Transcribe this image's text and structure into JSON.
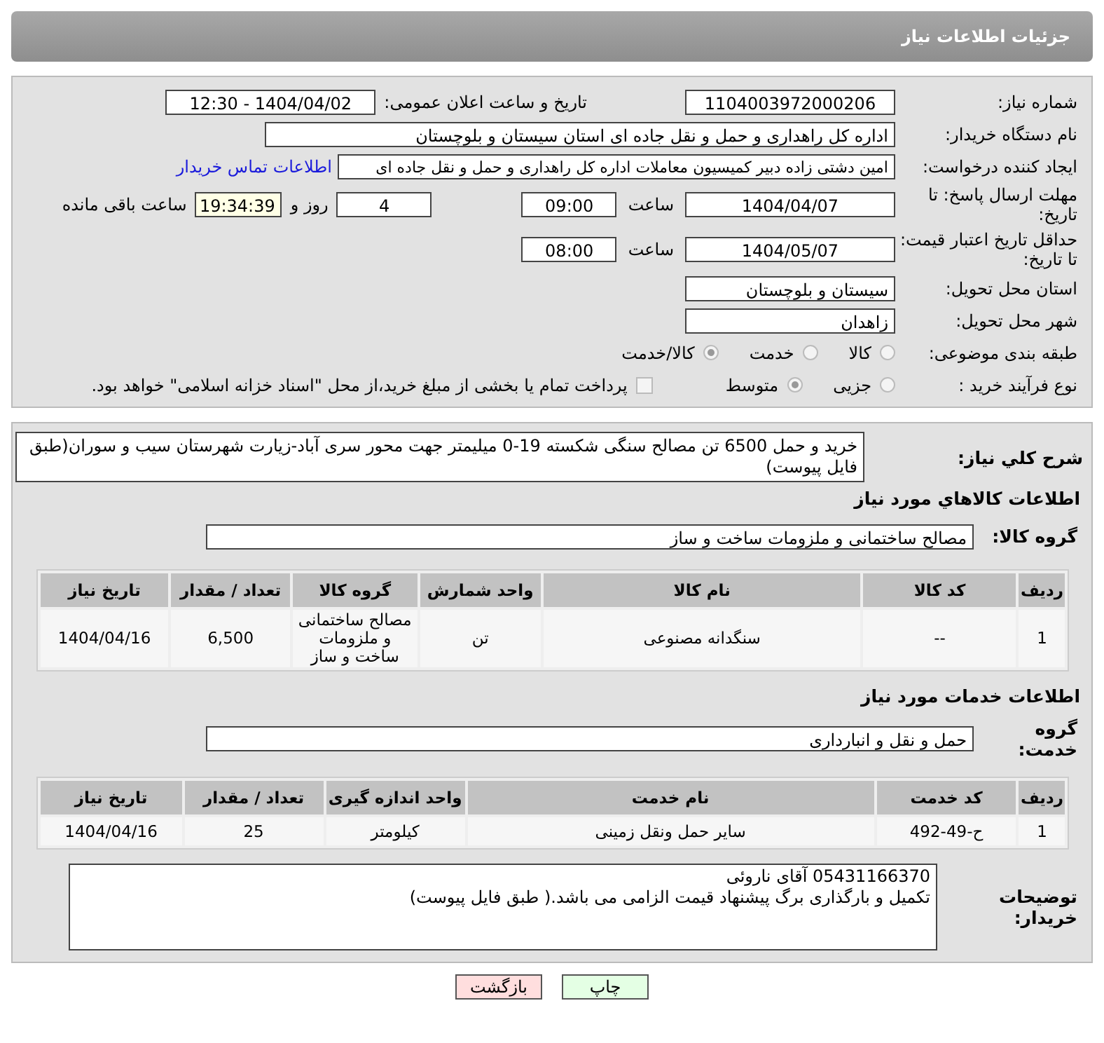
{
  "header": {
    "title": "جزئیات اطلاعات نیاز"
  },
  "need_number": {
    "label": "شماره نیاز:",
    "value": "1104003972000206"
  },
  "announce": {
    "label": "تاریخ و ساعت اعلان عمومی:",
    "value": "1404/04/02 - 12:30"
  },
  "buyer_org": {
    "label": "نام دستگاه خریدار:",
    "value": "اداره کل راهداری و حمل و نقل جاده ای استان سیستان و بلوچستان"
  },
  "requester": {
    "label": "ایجاد کننده درخواست:",
    "value": "امین دشتی زاده دبیر کمیسیون معاملات اداره کل راهداری و حمل و نقل جاده ای",
    "contact_link": "اطلاعات تماس خریدار"
  },
  "reply_deadline": {
    "label": "مهلت ارسال پاسخ: تا تاریخ:",
    "date": "1404/04/07",
    "time_label": "ساعت",
    "time": "09:00",
    "days": "4",
    "days_label": "روز و",
    "remaining": "19:34:39",
    "remaining_label": "ساعت باقی مانده"
  },
  "price_validity": {
    "label": "حداقل تاریخ اعتبار قیمت: تا تاریخ:",
    "date": "1404/05/07",
    "time_label": "ساعت",
    "time": "08:00"
  },
  "province": {
    "label": "استان محل تحویل:",
    "value": "سیستان و بلوچستان"
  },
  "city": {
    "label": "شهر محل تحویل:",
    "value": "زاهدان"
  },
  "category": {
    "label": "طبقه بندی موضوعی:",
    "options": [
      {
        "label": "کالا",
        "selected": false
      },
      {
        "label": "خدمت",
        "selected": false
      },
      {
        "label": "کالا/خدمت",
        "selected": true
      }
    ]
  },
  "process": {
    "label": "نوع فرآیند خرید :",
    "options": [
      {
        "label": "جزیی",
        "selected": false
      },
      {
        "label": "متوسط",
        "selected": true
      }
    ],
    "payment": {
      "checked": false,
      "text": "پرداخت تمام یا بخشی از مبلغ خرید،از محل \"اسناد خزانه اسلامی\" خواهد بود."
    }
  },
  "description": {
    "label": "شرح کلي نياز:",
    "value": "خرید و حمل 6500 تن مصالح سنگی شکسته 19-0 میلیمتر جهت محور سری آباد-زیارت شهرستان سیب و سوران(طبق فایل پیوست)"
  },
  "goods": {
    "title": "اطلاعات کالاهاي مورد نياز",
    "group_label": "گروه کالا:",
    "group": "مصالح ساختمانی و ملزومات ساخت و ساز",
    "columns": [
      "ردیف",
      "کد کالا",
      "نام کالا",
      "واحد شمارش",
      "گروه کالا",
      "تعداد / مقدار",
      "تاریخ نیاز"
    ],
    "rows": [
      [
        "1",
        "--",
        "سنگدانه مصنوعی",
        "تن",
        "مصالح ساختمانی و ملزومات ساخت و ساز",
        "6,500",
        "1404/04/16"
      ]
    ]
  },
  "services": {
    "title": "اطلاعات خدمات مورد نیاز",
    "group_label": "گروه خدمت:",
    "group": "حمل و نقل و انبارداری",
    "columns": [
      "ردیف",
      "کد خدمت",
      "نام خدمت",
      "واحد اندازه گیری",
      "تعداد / مقدار",
      "تاریخ نیاز"
    ],
    "rows": [
      [
        "1",
        "ح-49-492",
        "سایر حمل ونقل زمینی",
        "کیلومتر",
        "25",
        "1404/04/16"
      ]
    ]
  },
  "buyer_notes": {
    "label": "توضیحات خریدار:",
    "lines": [
      "05431166370 آقای ناروئی",
      "تکمیل و بارگذاری برگ پیشنهاد قیمت الزامی می باشد.( طبق فایل پیوست)"
    ]
  },
  "buttons": [
    {
      "kind": "print",
      "label": "چاپ"
    },
    {
      "kind": "back",
      "label": "بازگشت"
    }
  ]
}
